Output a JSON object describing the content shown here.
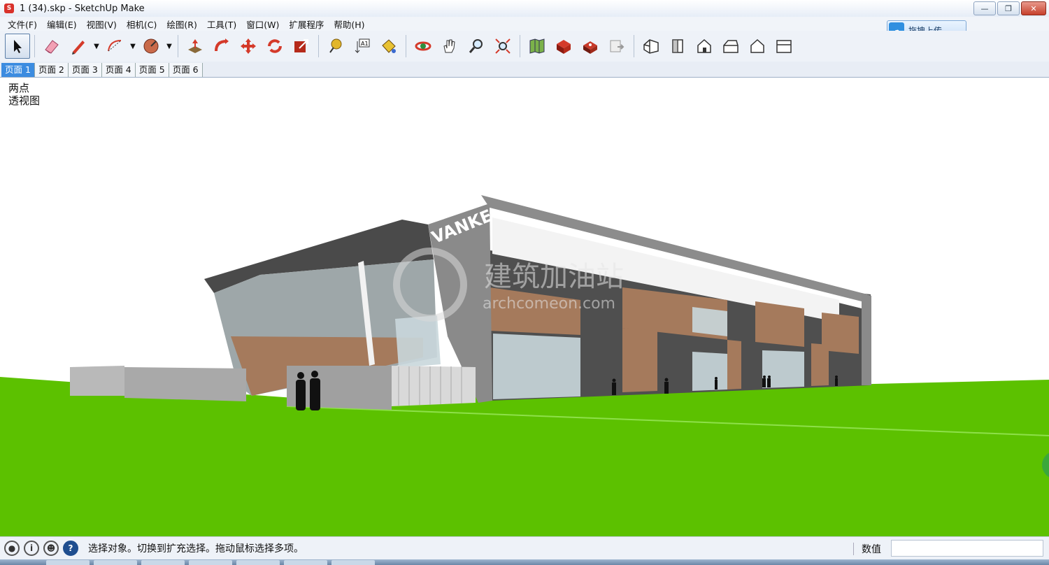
{
  "window": {
    "title": "1 (34).skp - SketchUp Make",
    "icon": "sketchup-icon",
    "controls": [
      "minimize",
      "restore",
      "close"
    ]
  },
  "menu": {
    "items": [
      "文件(F)",
      "编辑(E)",
      "视图(V)",
      "相机(C)",
      "绘图(R)",
      "工具(T)",
      "窗口(W)",
      "扩展程序",
      "帮助(H)"
    ]
  },
  "upload": {
    "label": "拖拽上传"
  },
  "tabs": [
    {
      "label": "页面 1",
      "active": true
    },
    {
      "label": "页面 2",
      "active": false
    },
    {
      "label": "页面 3",
      "active": false
    },
    {
      "label": "页面 4",
      "active": false
    },
    {
      "label": "页面 5",
      "active": false
    },
    {
      "label": "页面 6",
      "active": false
    }
  ],
  "viewport": {
    "label_line1": "两点",
    "label_line2": "透视图",
    "watermark_title": "建筑加油站",
    "watermark_url": "archcomeon.com",
    "signage": "VANKE",
    "colors": {
      "ground": "#5cc100",
      "roof": "#4a4a4a",
      "cladding": "#a57a5c",
      "stone": "#6b6b6b",
      "glass": "#c9d7dc"
    }
  },
  "status": {
    "message": "选择对象。切换到扩充选择。拖动鼠标选择多项。",
    "measure_label": "数值",
    "measure_value": ""
  }
}
